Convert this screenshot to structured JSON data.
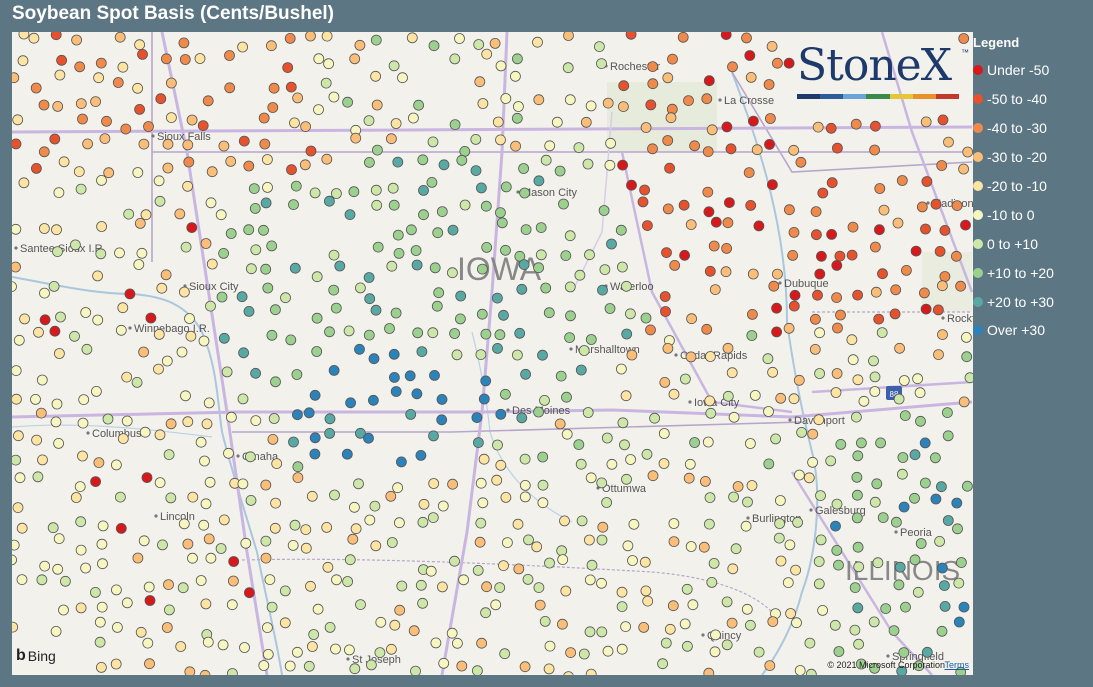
{
  "title": "Soybean Spot Basis (Cents/Bushel)",
  "legend": {
    "title": "Legend",
    "items": [
      {
        "label": "Under -50",
        "color": "#d7191c"
      },
      {
        "label": "-50 to -40",
        "color": "#e5522d"
      },
      {
        "label": "-40 to -30",
        "color": "#f08a4b"
      },
      {
        "label": "-30 to -20",
        "color": "#fbbe78"
      },
      {
        "label": "-20 to -10",
        "color": "#fde4a3"
      },
      {
        "label": "-10 to 0",
        "color": "#f7f6c0"
      },
      {
        "label": "0 to +10",
        "color": "#cde7a9"
      },
      {
        "label": "+10 to +20",
        "color": "#9bd08f"
      },
      {
        "label": "+20 to +30",
        "color": "#58a8a3"
      },
      {
        "label": "Over +30",
        "color": "#2b83ba"
      }
    ]
  },
  "logo": {
    "text": "StoneX",
    "tm": "™",
    "bar_colors": [
      "#1d3a6b",
      "#2c5c9a",
      "#6aa4d8",
      "#3a8a4a",
      "#e6c53a",
      "#e8922c",
      "#c0392b"
    ]
  },
  "map": {
    "state_label": "IOWA",
    "state_label_2": "ILLINOIS",
    "cities": [
      "Rochester",
      "La Crosse",
      "Sioux Falls",
      "Mason City",
      "Madison",
      "Santee Sioux I.R.",
      "Sioux City",
      "Waterloo",
      "Dubuque",
      "Winnebago I.R.",
      "Omaha",
      "Marshalltown",
      "Cedar Rapids",
      "Rockford",
      "Iowa City",
      "Davenport",
      "Columbus",
      "Des Moines",
      "Ottumwa",
      "Lincoln",
      "Burlington",
      "Galesburg",
      "Peoria",
      "Quincy",
      "Springfield",
      "St Joseph"
    ],
    "highway_label": "88"
  },
  "bing_label": "Bing",
  "copyright": "© 2021 Microsoft Corporation",
  "terms": "Terms"
}
